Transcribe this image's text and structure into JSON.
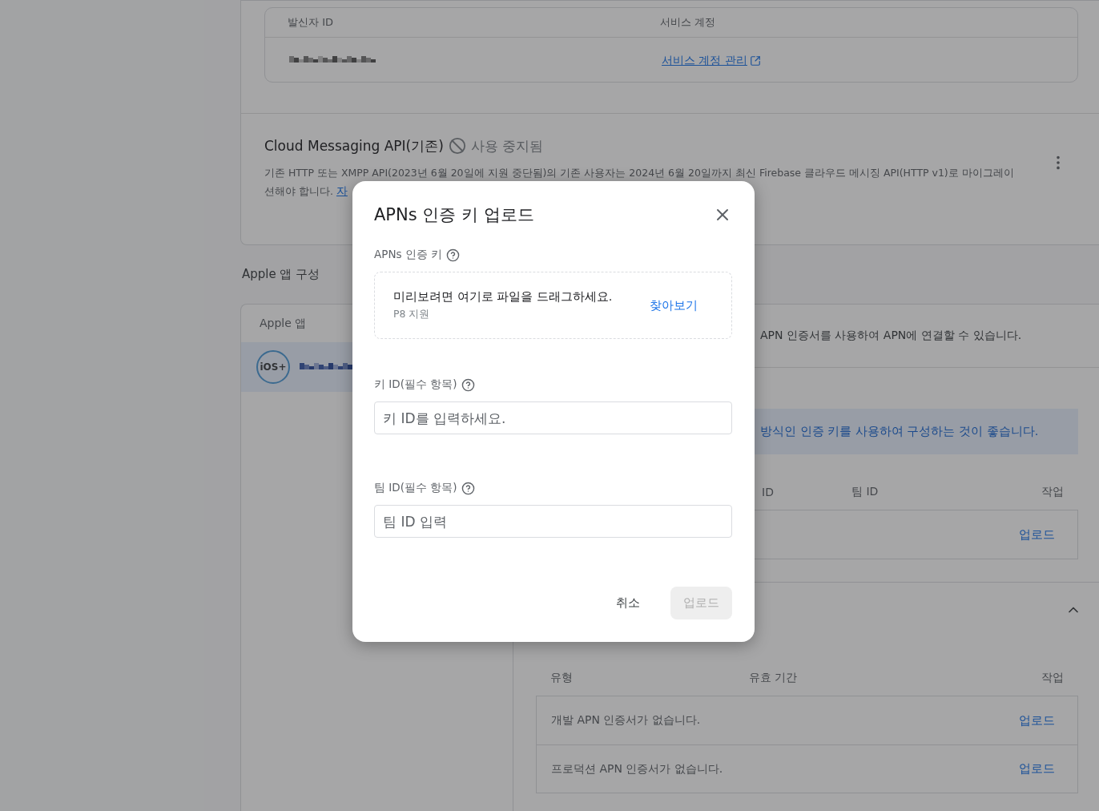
{
  "sender_table": {
    "columns": [
      "발신자 ID",
      "서비스 계정"
    ],
    "link": "서비스 계정 관리"
  },
  "legacy_api": {
    "title": "Cloud Messaging API(기존)",
    "status": "사용 중지됨",
    "description_lines": [
      "기존 HTTP 또는 XMPP API(2023년 6월 20일에 지원 중단됨)의 기존 사용자는 2024년 6월 20일까지 최신 Firebase 클라우드 메시징 API(HTTP v1)로 마이그레이",
      "션해야 합니다."
    ],
    "link": "자"
  },
  "apple_section": {
    "heading": "Apple 앱 구성",
    "apps_header": "Apple 앱",
    "apps": [
      {
        "badge": "iOS+",
        "selected": true
      }
    ]
  },
  "apns_intro": "APN 인증서를 사용하여 APN에 연결할 수 있습니다.",
  "recommendation": "방식인 인증 키를 사용하여 구성하는 것이 좋습니다.",
  "key_table": {
    "columns": [
      "ID",
      "팀 ID",
      "작업"
    ],
    "rows": [
      {
        "action": "업로드"
      }
    ]
  },
  "certificates": {
    "expanded": true,
    "columns": [
      "유형",
      "유효 기간",
      "작업"
    ],
    "rows": [
      {
        "type": "개발 APN 인증서가 없습니다.",
        "action": "업로드"
      },
      {
        "type": "프로덕션 APN 인증서가 없습니다.",
        "action": "업로드"
      }
    ]
  },
  "dialog": {
    "title": "APNs 인증 키 업로드",
    "key_file": {
      "label": "APNs 인증 키",
      "dropzone_text": "미리보려면 여기로 파일을 드래그하세요.",
      "hint": "P8 지원",
      "browse": "찾아보기"
    },
    "fields": [
      {
        "label": "키 ID(필수 항목)",
        "placeholder": "키 ID를 입력하세요."
      },
      {
        "label": "팀 ID(필수 항목)",
        "placeholder": "팀 ID 입력"
      }
    ],
    "buttons": [
      {
        "label": "취소",
        "kind": "text",
        "disabled": false
      },
      {
        "label": "업로드",
        "kind": "filled",
        "disabled": true
      }
    ]
  }
}
